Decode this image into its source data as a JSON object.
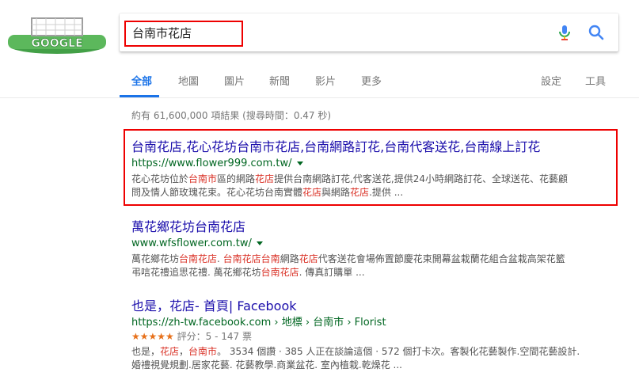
{
  "search": {
    "query": "台南市花店",
    "logo_text": "GOOGLE"
  },
  "tabs": {
    "all": "全部",
    "maps": "地圖",
    "images": "圖片",
    "news": "新聞",
    "videos": "影片",
    "more": "更多",
    "settings": "設定",
    "tools": "工具"
  },
  "stats": "約有 61,600,000 項結果 (搜尋時間：0.47 秒)",
  "results": [
    {
      "title": "台南花店,花心花坊台南市花店,台南網路訂花,台南代客送花,台南線上訂花",
      "url": "https://www.flower999.com.tw/",
      "snippet_1a": "花心花坊位於",
      "snippet_1b": "台南市",
      "snippet_1c": "區的網路",
      "snippet_1d": "花店",
      "snippet_1e": "提供台南網路訂花,代客送花,提供24小時網路訂花、全球送花、花藝顧",
      "snippet_2a": "問及情人節玫瑰花束。花心花坊台南實體",
      "snippet_2b": "花店",
      "snippet_2c": "與網路",
      "snippet_2d": "花店",
      "snippet_2e": ".提供 ..."
    },
    {
      "title": "萬花鄉花坊台南花店",
      "url": "www.wfsflower.com.tw/",
      "snippet_1a": "萬花鄉花坊",
      "snippet_1b": "台南花店",
      "snippet_1c": ". ",
      "snippet_1d": "台南花店台南",
      "snippet_1e": "網路",
      "snippet_1f": "花店",
      "snippet_1g": "代客送花會場佈置節慶花束開幕盆栽蘭花組合盆栽高架花籃",
      "snippet_2a": "弔唁花禮追思花禮. 萬花鄉花坊",
      "snippet_2b": "台南花店",
      "snippet_2c": ". 傳真訂購單 ..."
    },
    {
      "title": "也是，花店- 首頁| Facebook",
      "url": "https://zh-tw.facebook.com › 地標 › 台南市 › Florist",
      "stars": "★★★★★",
      "rating": "評分：5 - 147 票",
      "snippet_1a": "也是，",
      "snippet_1b": "花店",
      "snippet_1c": "，",
      "snippet_1d": "台南市",
      "snippet_1e": "。 3534 個讚 · 385 人正在談論這個 · 572 個打卡次。客製化花藝製作.空間花藝設計.",
      "snippet_2": "婚禮視覺規劃.居家花藝. 花藝教學.商業盆花. 室內植栽.乾燥花 ..."
    }
  ],
  "colors": {
    "link": "#1a0dab",
    "url": "#006621",
    "accent": "#1a73e8",
    "highlight_box": "#e00000"
  }
}
